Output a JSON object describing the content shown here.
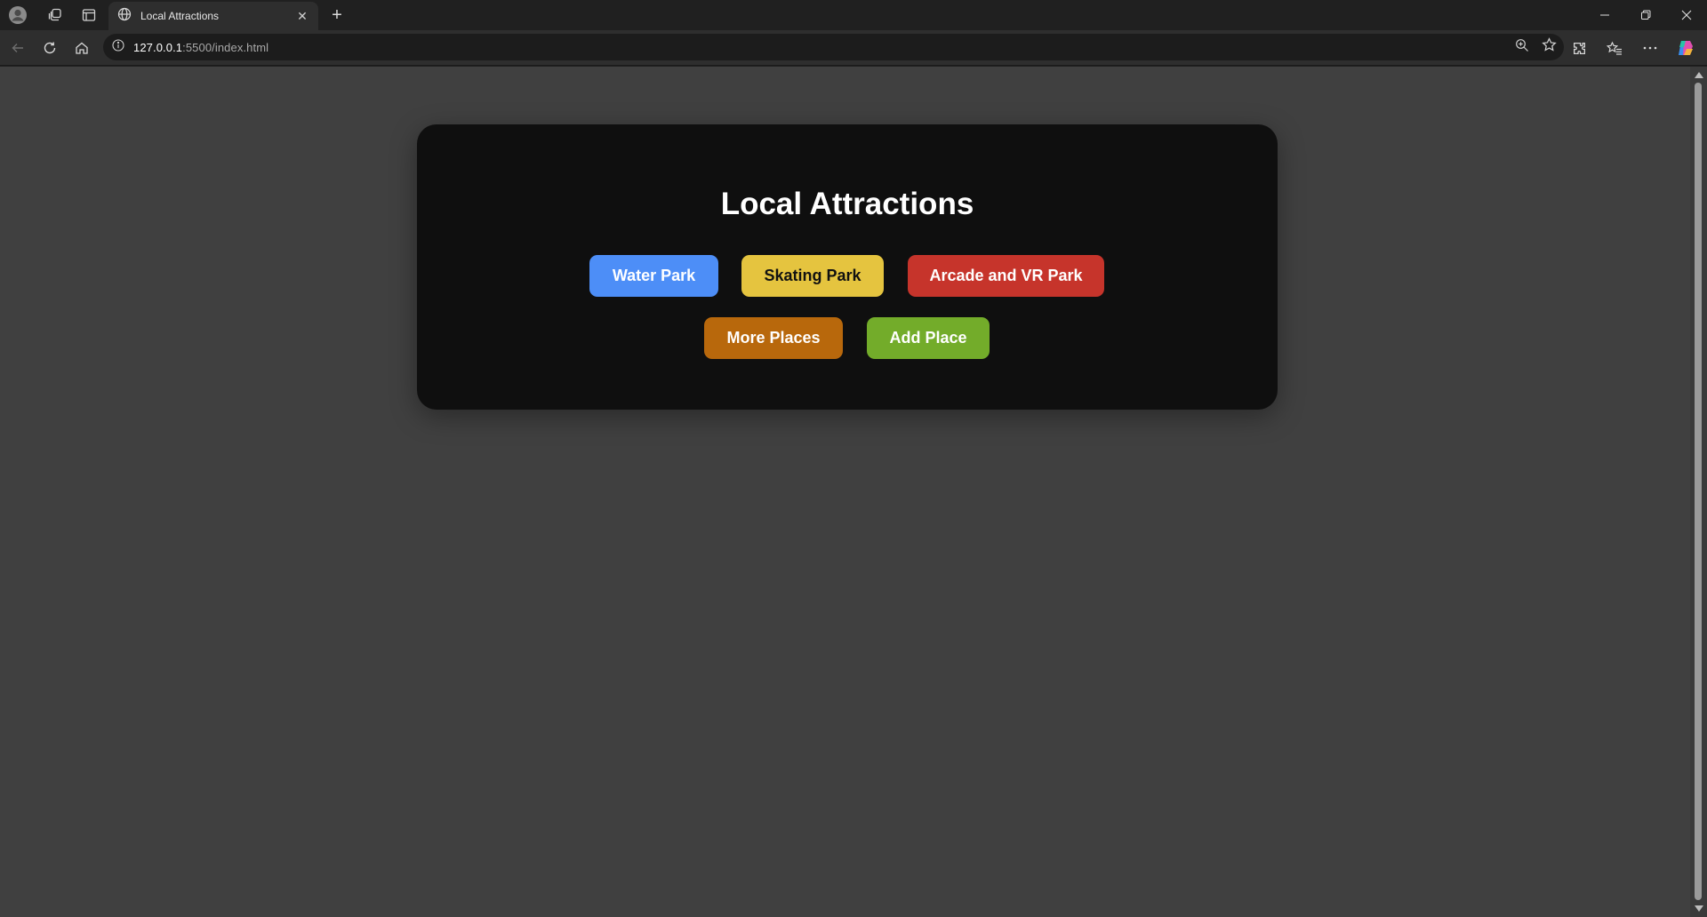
{
  "browser": {
    "tab": {
      "title": "Local Attractions"
    },
    "address": {
      "host": "127.0.0.1",
      "path": ":5500/index.html"
    },
    "icons": [
      "profile-icon",
      "workspaces-icon",
      "sidebar-icon",
      "globe-icon",
      "close-icon",
      "plus-icon",
      "minimize-icon",
      "restore-icon",
      "window-close-icon",
      "back-icon",
      "refresh-icon",
      "home-icon",
      "info-icon",
      "zoom-icon",
      "star-icon",
      "extensions-icon",
      "favorites-icon",
      "more-icon",
      "copilot-icon"
    ]
  },
  "page": {
    "title": "Local Attractions",
    "background": "#404040",
    "card_background": "#0f0f0f",
    "buttons": [
      {
        "label": "Water Park",
        "color": "#4d8ef7",
        "text_color": "#ffffff"
      },
      {
        "label": "Skating Park",
        "color": "#e5c43f",
        "text_color": "#111111"
      },
      {
        "label": "Arcade and VR Park",
        "color": "#c6342b",
        "text_color": "#ffffff"
      },
      {
        "label": "More Places",
        "color": "#b8680c",
        "text_color": "#ffffff"
      },
      {
        "label": "Add Place",
        "color": "#73ac2a",
        "text_color": "#ffffff"
      }
    ]
  }
}
